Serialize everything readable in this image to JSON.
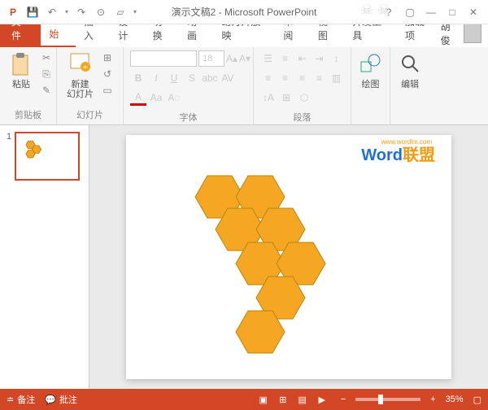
{
  "title": "演示文稿2 - Microsoft PowerPoint",
  "qat": {
    "ppt_icon": "P",
    "save": "💾",
    "undo": "↶",
    "redo": "↷",
    "start": "⊙",
    "blank": "▱"
  },
  "win": {
    "help": "?",
    "full": "▢",
    "min": "—",
    "max": "□",
    "close": "✕"
  },
  "tabs": {
    "file": "文件",
    "items": [
      "开始",
      "插入",
      "设计",
      "切换",
      "动画",
      "幻灯片放映",
      "审阅",
      "视图",
      "开发工具",
      "加载项"
    ],
    "active": 0
  },
  "user": {
    "name": "胡俊"
  },
  "ribbon": {
    "clipboard": {
      "label": "剪贴板",
      "paste": "粘贴",
      "cut": "✂",
      "copy": "⎘",
      "fmt": "✎"
    },
    "slides": {
      "label": "幻灯片",
      "new": "新建\n幻灯片",
      "layout": "⊞",
      "reset": "↺",
      "section": "▭"
    },
    "font": {
      "label": "字体",
      "name_ph": "",
      "size": "18"
    },
    "para": {
      "label": "段落"
    },
    "draw": {
      "label": "绘图"
    },
    "edit": {
      "label": "编辑"
    }
  },
  "thumb": {
    "num": "1"
  },
  "watermark": {
    "w": "W",
    "ord": "ord",
    "lm": "联盟",
    "url": "www.wordlm.com"
  },
  "status": {
    "notes": "备注",
    "comments": "批注",
    "zoom": "35%",
    "fit": "▢"
  }
}
